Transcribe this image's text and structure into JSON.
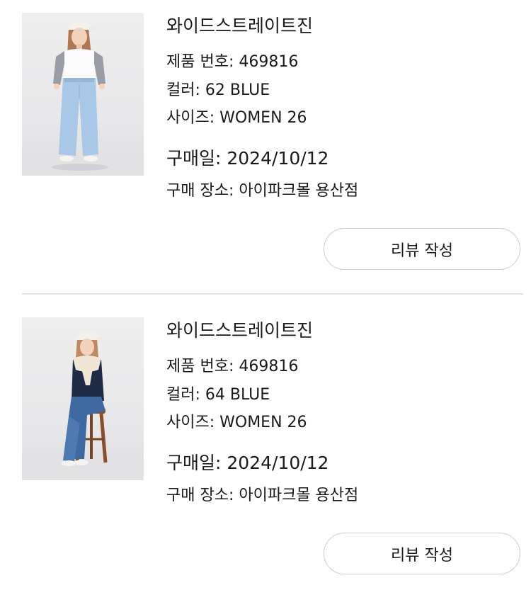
{
  "orders": [
    {
      "product_name": "와이드스트레이트진",
      "product_number": "제품 번호: 469816",
      "color": "컬러: 62 BLUE",
      "size": "사이즈: WOMEN 26",
      "purchase_date": "구매일: 2024/10/12",
      "purchase_store": "구매 장소: 아이파크몰 용산점",
      "review_button_label": "리뷰 작성",
      "image_alt": "woman-standing-light-blue-jeans"
    },
    {
      "product_name": "와이드스트레이트진",
      "product_number": "제품 번호: 469816",
      "color": "컬러: 64 BLUE",
      "size": "사이즈: WOMEN 26",
      "purchase_date": "구매일: 2024/10/12",
      "purchase_store": "구매 장소: 아이파크몰 용산점",
      "review_button_label": "리뷰 작성",
      "image_alt": "woman-seated-on-stool-blue-jeans"
    }
  ],
  "colors": {
    "button_border": "#cfcfcf",
    "divider": "#e2e2e2",
    "text": "#1a1a1a"
  }
}
